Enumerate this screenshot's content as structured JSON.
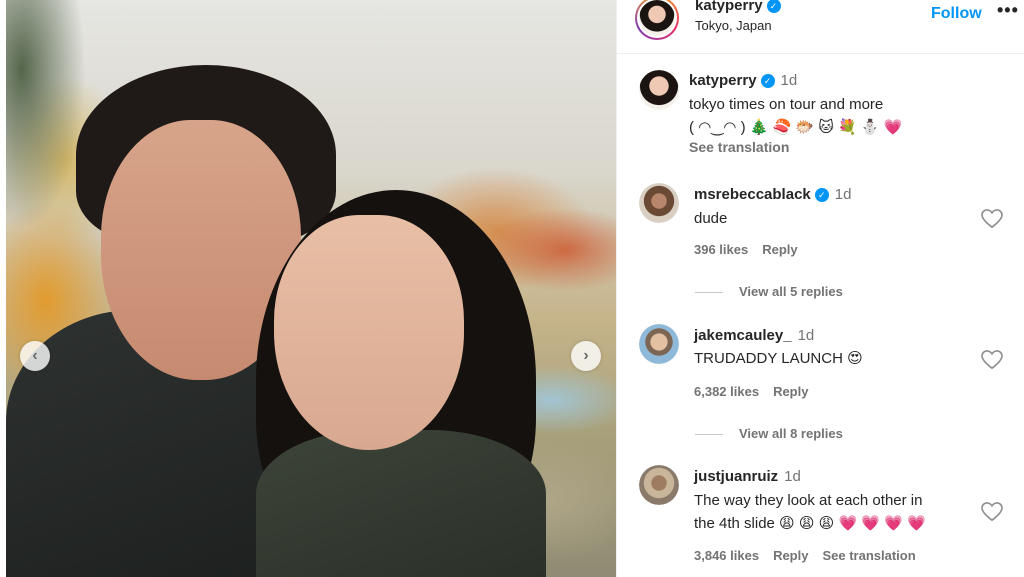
{
  "post": {
    "author": {
      "username": "katyperry",
      "location": "Tokyo, Japan",
      "verified_mark": "✓"
    },
    "follow_label": "Follow",
    "more_label": "•••",
    "carousel": {
      "prev_icon": "‹",
      "next_icon": "›"
    },
    "caption": {
      "username": "katyperry",
      "time": "1d",
      "line1": "tokyo times on tour and more",
      "line2": "( ◠‿◠ ) 🎄 🍣 🐡 🐱 💐 ⛄ 💗",
      "see_translation": "See translation"
    }
  },
  "comments": [
    {
      "username": "msrebeccablack",
      "verified": true,
      "time": "1d",
      "text": "dude",
      "likes": "396 likes",
      "reply": "Reply",
      "view_replies": "View all 5 replies"
    },
    {
      "username": "jakemcauley_",
      "verified": false,
      "time": "1d",
      "text": "TRUDADDY LAUNCH 😍",
      "likes": "6,382 likes",
      "reply": "Reply",
      "view_replies": "View all 8 replies"
    },
    {
      "username": "justjuanruiz",
      "verified": false,
      "time": "1d",
      "text_line1": "The way they look at each other in",
      "text_line2": "the 4th slide 😩 😩 😩 💗 💗 💗 💗",
      "likes": "3,846 likes",
      "reply": "Reply",
      "see_translation": "See translation"
    }
  ],
  "icons": {
    "heart": "heart-outline-icon",
    "verified": "verified-badge-icon"
  },
  "colors": {
    "accent": "#0095f6",
    "muted": "#737373",
    "text": "#262626"
  }
}
